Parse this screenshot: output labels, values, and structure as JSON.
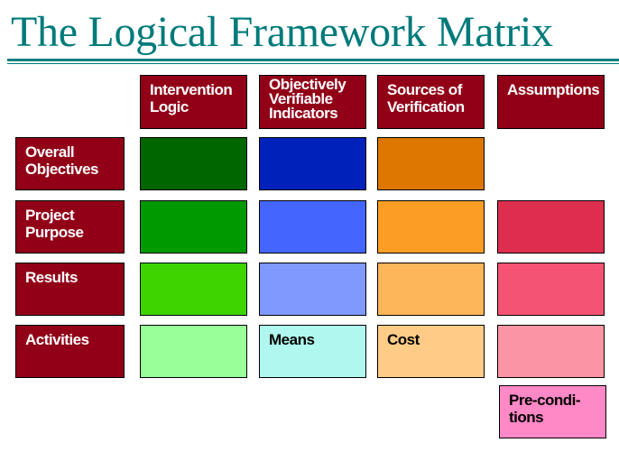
{
  "title": "The Logical Framework Matrix",
  "columns": [
    {
      "label": "Intervention\nLogic"
    },
    {
      "label": "Objectively\nVerifiable\nIndicators"
    },
    {
      "label": "Sources of\nVerification"
    },
    {
      "label": "Assumptions"
    }
  ],
  "rows": [
    {
      "label": "Overall\nObjectives",
      "cells": [
        {
          "text": "",
          "color": "#006600"
        },
        {
          "text": "",
          "color": "#0022bb"
        },
        {
          "text": "",
          "color": "#dd7700"
        },
        null
      ]
    },
    {
      "label": "Project\nPurpose",
      "cells": [
        {
          "text": "",
          "color": "#009900"
        },
        {
          "text": "",
          "color": "#4466ff"
        },
        {
          "text": "",
          "color": "#fc9e26"
        },
        {
          "text": "",
          "color": "#dd2e4e"
        }
      ]
    },
    {
      "label": "Results",
      "cells": [
        {
          "text": "",
          "color": "#3dd400"
        },
        {
          "text": "",
          "color": "#8099ff"
        },
        {
          "text": "",
          "color": "#fdb659"
        },
        {
          "text": "",
          "color": "#f55373"
        }
      ]
    },
    {
      "label": "Activities",
      "cells": [
        {
          "text": "",
          "color": "#99ff99"
        },
        {
          "text": "Means",
          "color": "#aff7ef"
        },
        {
          "text": "Cost",
          "color": "#ffcc88"
        },
        {
          "text": "",
          "color": "#fb94a4"
        }
      ]
    }
  ],
  "preconditions": {
    "label": "Pre-condi-\ntions",
    "color": "#ff88c6"
  },
  "colors": {
    "header_bg": "#910017",
    "title": "#007a7a",
    "rule": "#008080"
  }
}
